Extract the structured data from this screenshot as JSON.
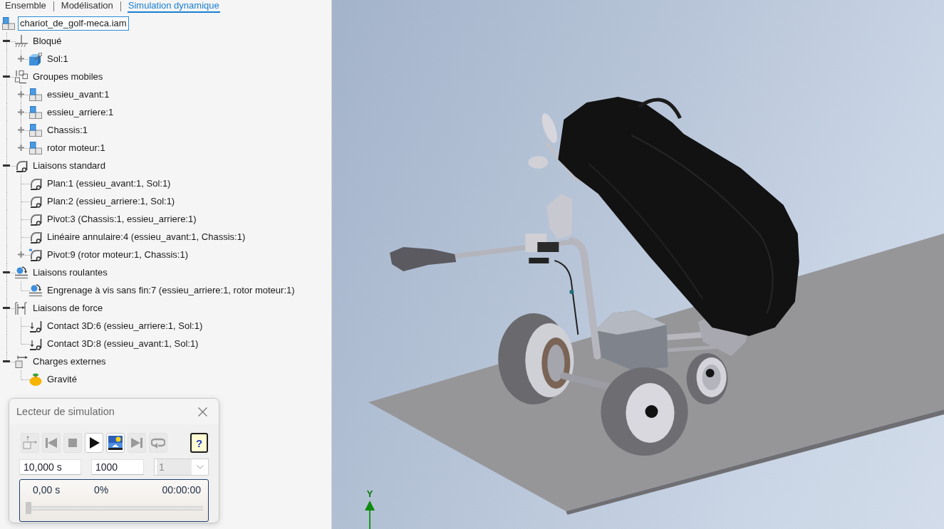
{
  "tabs": [
    {
      "label": "Ensemble",
      "selected": false
    },
    {
      "label": "Modélisation",
      "selected": false
    },
    {
      "label": "Simulation dynamique",
      "selected": true
    }
  ],
  "tree": [
    {
      "label": "chariot_de_golf-meca.iam",
      "kind": "assembly",
      "selected": true,
      "expander": false,
      "children": [
        {
          "label": "Bloqué",
          "kind": "ground",
          "selected": false,
          "expander": true,
          "expanded": true,
          "children": [
            {
              "label": "Sol:1",
              "kind": "part-pinned",
              "selected": false,
              "expander": true,
              "expanded": false
            }
          ]
        },
        {
          "label": "Groupes mobiles",
          "kind": "groups",
          "selected": false,
          "expander": true,
          "expanded": true,
          "children": [
            {
              "label": "essieu_avant:1",
              "kind": "part",
              "selected": false,
              "expander": true,
              "expanded": false
            },
            {
              "label": "essieu_arriere:1",
              "kind": "part",
              "selected": false,
              "expander": true,
              "expanded": false
            },
            {
              "label": "Chassis:1",
              "kind": "part",
              "selected": false,
              "expander": true,
              "expanded": false
            },
            {
              "label": "rotor moteur:1",
              "kind": "part",
              "selected": false,
              "expander": true,
              "expanded": false
            }
          ]
        },
        {
          "label": "Liaisons standard",
          "kind": "joint",
          "selected": false,
          "expander": true,
          "expanded": true,
          "children": [
            {
              "label": "Plan:1 (essieu_avant:1, Sol:1)",
              "kind": "joint",
              "selected": false,
              "expander": false
            },
            {
              "label": "Plan:2 (essieu_arriere:1, Sol:1)",
              "kind": "joint",
              "selected": false,
              "expander": false
            },
            {
              "label": "Pivot:3 (Chassis:1, essieu_arriere:1)",
              "kind": "joint",
              "selected": false,
              "expander": false
            },
            {
              "label": "Linéaire annulaire:4 (essieu_avant:1, Chassis:1)",
              "kind": "joint",
              "selected": false,
              "expander": false
            },
            {
              "label": "Pivot:9 (rotor moteur:1, Chassis:1)",
              "kind": "joint-flagged",
              "selected": false,
              "expander": true,
              "expanded": false
            }
          ]
        },
        {
          "label": "Liaisons roulantes",
          "kind": "rolling",
          "selected": false,
          "expander": true,
          "expanded": true,
          "children": [
            {
              "label": "Engrenage à vis sans fin:7 (essieu_arriere:1, rotor moteur:1)",
              "kind": "rolling",
              "selected": false,
              "expander": false
            }
          ]
        },
        {
          "label": "Liaisons de force",
          "kind": "force",
          "selected": false,
          "expander": true,
          "expanded": true,
          "children": [
            {
              "label": "Contact 3D:6 (essieu_arriere:1, Sol:1)",
              "kind": "contact",
              "selected": false,
              "expander": false
            },
            {
              "label": "Contact 3D:8 (essieu_avant:1, Sol:1)",
              "kind": "contact",
              "selected": false,
              "expander": false
            }
          ]
        },
        {
          "label": "Charges externes",
          "kind": "loads",
          "selected": false,
          "expander": true,
          "expanded": true,
          "children": [
            {
              "label": "Gravité",
              "kind": "gravity",
              "selected": false,
              "expander": false
            }
          ]
        }
      ]
    }
  ],
  "player": {
    "title": "Lecteur de simulation",
    "buttons": [
      {
        "kind": "construction",
        "disabled": true
      },
      {
        "kind": "rewind",
        "disabled": true
      },
      {
        "kind": "stop",
        "disabled": true
      },
      {
        "kind": "play",
        "disabled": false
      },
      {
        "kind": "record",
        "disabled": false
      },
      {
        "kind": "end",
        "disabled": true
      },
      {
        "kind": "loop",
        "disabled": true
      },
      {
        "kind": "help",
        "glyph": "?",
        "disabled": false
      }
    ],
    "end_time": "10,000 s",
    "frames": "1000",
    "step": {
      "value": "1",
      "disabled": true
    },
    "progress": {
      "time": "0,00 s",
      "percent": "0%",
      "clock": "00:00:00",
      "level": 0
    }
  },
  "viewport": {
    "axis_label": "Y"
  }
}
